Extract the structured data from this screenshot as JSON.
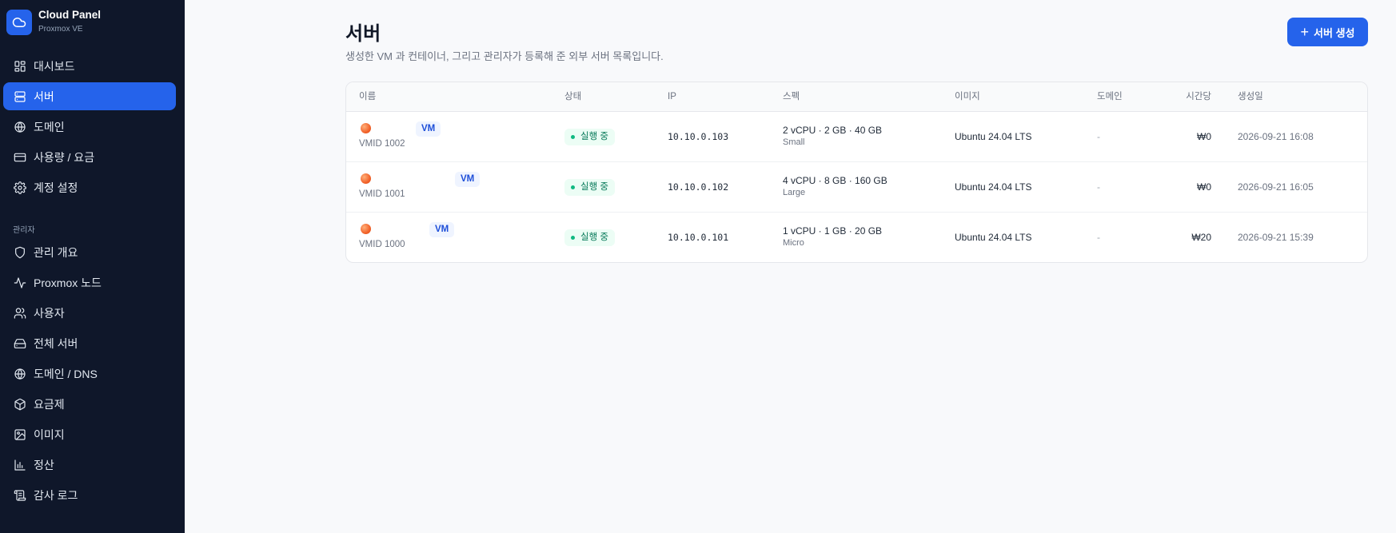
{
  "brand": {
    "title": "Cloud Panel",
    "subtitle": "Proxmox VE"
  },
  "nav": [
    {
      "label": "대시보드",
      "icon": "dashboard-icon"
    },
    {
      "label": "서버",
      "icon": "server-icon",
      "active": true
    },
    {
      "label": "도메인",
      "icon": "globe-icon"
    },
    {
      "label": "사용량 / 요금",
      "icon": "credit-card-icon"
    },
    {
      "label": "계정 설정",
      "icon": "gear-icon"
    }
  ],
  "admin_section_label": "관리자",
  "admin_nav": [
    {
      "label": "관리 개요",
      "icon": "shield-icon"
    },
    {
      "label": "Proxmox 노드",
      "icon": "activity-icon"
    },
    {
      "label": "사용자",
      "icon": "users-icon"
    },
    {
      "label": "전체 서버",
      "icon": "hard-drive-icon"
    },
    {
      "label": "도메인 / DNS",
      "icon": "globe-icon"
    },
    {
      "label": "요금제",
      "icon": "package-icon"
    },
    {
      "label": "이미지",
      "icon": "image-icon"
    },
    {
      "label": "정산",
      "icon": "bar-chart-icon"
    },
    {
      "label": "감사 로그",
      "icon": "scroll-icon"
    }
  ],
  "header": {
    "title": "서버",
    "subtitle": "생성한 VM 과 컨테이너, 그리고 관리자가 등록해 준 외부 서버 목록입니다.",
    "create_button": "서버 생성"
  },
  "table": {
    "columns": [
      "이름",
      "상태",
      "IP",
      "스펙",
      "이미지",
      "도메인",
      "시간당",
      "생성일"
    ],
    "rows": [
      {
        "type": "VM",
        "vmid": "VMID 1002",
        "status": "실행 중",
        "ip": "10.10.0.103",
        "spec": "2 vCPU · 2 GB · 40 GB",
        "plan": "Small",
        "image": "Ubuntu 24.04 LTS",
        "domain": "-",
        "hourly": "₩0",
        "created": "2026-09-21 16:08"
      },
      {
        "type": "VM",
        "vmid": "VMID 1001",
        "status": "실행 중",
        "ip": "10.10.0.102",
        "spec": "4 vCPU · 8 GB · 160 GB",
        "plan": "Large",
        "image": "Ubuntu 24.04 LTS",
        "domain": "-",
        "hourly": "₩0",
        "created": "2026-09-21 16:05"
      },
      {
        "type": "VM",
        "vmid": "VMID 1000",
        "status": "실행 중",
        "ip": "10.10.0.101",
        "spec": "1 vCPU · 1 GB · 20 GB",
        "plan": "Micro",
        "image": "Ubuntu 24.04 LTS",
        "domain": "-",
        "hourly": "₩20",
        "created": "2026-09-21 15:39"
      }
    ]
  },
  "colors": {
    "accent": "#2563eb",
    "sidebar_bg": "#0f172a",
    "status_green": "#047857"
  }
}
